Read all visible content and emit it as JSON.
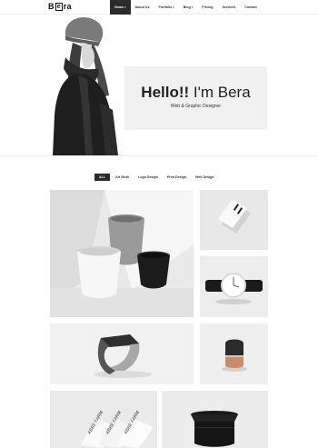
{
  "brand": {
    "logo_text_pre": "B",
    "logo_mark": "e",
    "logo_text_post": "ra"
  },
  "nav": {
    "items": [
      {
        "label": "Home",
        "active": true,
        "dropdown": true
      },
      {
        "label": "About Us",
        "active": false,
        "dropdown": false
      },
      {
        "label": "Portfolio",
        "active": false,
        "dropdown": true
      },
      {
        "label": "Blog",
        "active": false,
        "dropdown": true
      },
      {
        "label": "Pricing",
        "active": false,
        "dropdown": false
      },
      {
        "label": "Services",
        "active": false,
        "dropdown": false
      },
      {
        "label": "Contact",
        "active": false,
        "dropdown": false
      }
    ]
  },
  "hero": {
    "greeting": "Hello!!",
    "name": " I'm Bera",
    "subtitle": "Web & Graphic Designer"
  },
  "filters": {
    "items": [
      {
        "label": "ALL",
        "active": true
      },
      {
        "label": "Art Work",
        "active": false
      },
      {
        "label": "Logo Design",
        "active": false
      },
      {
        "label": "Print Design",
        "active": false
      },
      {
        "label": "Web Design",
        "active": false
      }
    ]
  },
  "portfolio": {
    "items": [
      {
        "subject": "ceramic-cups"
      },
      {
        "subject": "business-card"
      },
      {
        "subject": "wrist-watch"
      },
      {
        "subject": "ring"
      },
      {
        "subject": "copper-lamp"
      },
      {
        "subject": "business-cards-stack",
        "card_text": "ABBE FARM"
      },
      {
        "subject": "black-speaker"
      }
    ]
  },
  "colors": {
    "nav_active_bg": "#2b2b2b",
    "hero_card_bg": "#f1f1f1",
    "tile_bg": "#ececec"
  }
}
